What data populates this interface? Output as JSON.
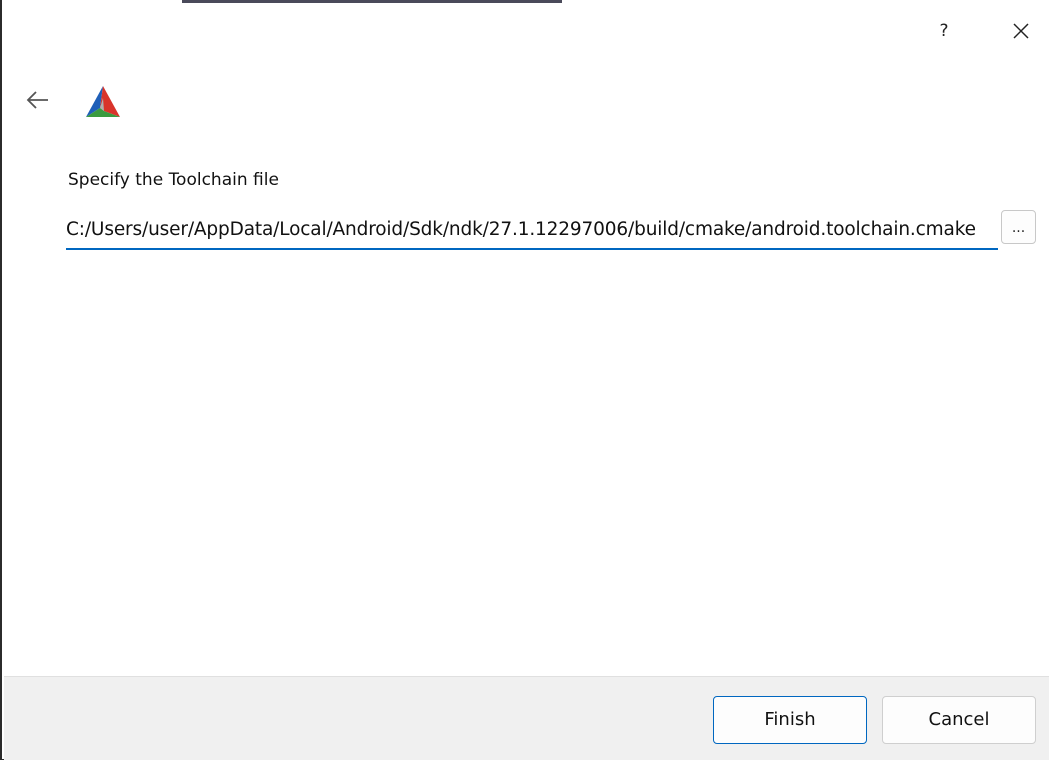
{
  "titlebar": {
    "help_label": "?",
    "close_icon": "close-icon"
  },
  "header": {
    "back_icon": "arrow-left-icon",
    "logo_icon": "cmake-logo-icon"
  },
  "main": {
    "label": "Specify the Toolchain file",
    "path_value": "C:/Users/user/AppData/Local/Android/Sdk/ndk/27.1.12297006/build/cmake/android.toolchain.cmake",
    "browse_label": "..."
  },
  "footer": {
    "finish_label": "Finish",
    "cancel_label": "Cancel"
  },
  "colors": {
    "accent": "#0067c0",
    "footer_bg": "#f0f0f0",
    "logo_red": "#d9342b",
    "logo_blue": "#1f5fb8",
    "logo_green": "#3a9a3f"
  }
}
